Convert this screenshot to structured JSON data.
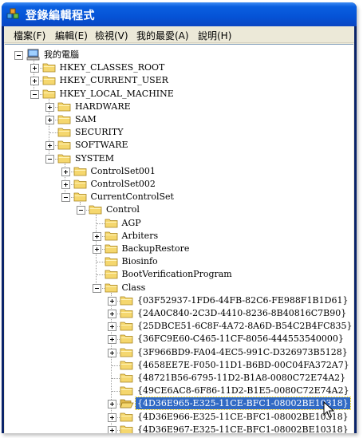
{
  "window": {
    "title": "登錄編輯程式"
  },
  "menu": [
    {
      "label": "檔案(F)"
    },
    {
      "label": "編輯(E)"
    },
    {
      "label": "檢視(V)"
    },
    {
      "label": "我的最愛(A)"
    },
    {
      "label": "說明(H)"
    }
  ],
  "tree": [
    {
      "label": "我的電腦",
      "level": 0,
      "state": "expanded",
      "icon": "computer-icon"
    },
    {
      "label": "HKEY_CLASSES_ROOT",
      "level": 1,
      "state": "collapsed",
      "icon": "folder-icon"
    },
    {
      "label": "HKEY_CURRENT_USER",
      "level": 1,
      "state": "collapsed",
      "icon": "folder-icon"
    },
    {
      "label": "HKEY_LOCAL_MACHINE",
      "level": 1,
      "state": "expanded",
      "icon": "folder-icon"
    },
    {
      "label": "HARDWARE",
      "level": 2,
      "state": "collapsed",
      "icon": "folder-icon"
    },
    {
      "label": "SAM",
      "level": 2,
      "state": "collapsed",
      "icon": "folder-icon"
    },
    {
      "label": "SECURITY",
      "level": 2,
      "state": "none",
      "icon": "folder-icon"
    },
    {
      "label": "SOFTWARE",
      "level": 2,
      "state": "collapsed",
      "icon": "folder-icon"
    },
    {
      "label": "SYSTEM",
      "level": 2,
      "state": "expanded",
      "icon": "folder-icon"
    },
    {
      "label": "ControlSet001",
      "level": 3,
      "state": "collapsed",
      "icon": "folder-icon"
    },
    {
      "label": "ControlSet002",
      "level": 3,
      "state": "collapsed",
      "icon": "folder-icon"
    },
    {
      "label": "CurrentControlSet",
      "level": 3,
      "state": "expanded",
      "icon": "folder-icon"
    },
    {
      "label": "Control",
      "level": 4,
      "state": "expanded",
      "icon": "folder-icon"
    },
    {
      "label": "AGP",
      "level": 5,
      "state": "none",
      "icon": "folder-icon"
    },
    {
      "label": "Arbiters",
      "level": 5,
      "state": "collapsed",
      "icon": "folder-icon"
    },
    {
      "label": "BackupRestore",
      "level": 5,
      "state": "collapsed",
      "icon": "folder-icon"
    },
    {
      "label": "Biosinfo",
      "level": 5,
      "state": "none",
      "icon": "folder-icon"
    },
    {
      "label": "BootVerificationProgram",
      "level": 5,
      "state": "none",
      "icon": "folder-icon"
    },
    {
      "label": "Class",
      "level": 5,
      "state": "expanded",
      "icon": "folder-icon"
    },
    {
      "label": "{03F52937-1FD6-44FB-82C6-FE988F1B1D61}",
      "level": 6,
      "state": "collapsed",
      "icon": "folder-icon"
    },
    {
      "label": "{24A0C840-2C3D-4410-8236-8B40816C7B90}",
      "level": 6,
      "state": "collapsed",
      "icon": "folder-icon"
    },
    {
      "label": "{25DBCE51-6C8F-4A72-8A6D-B54C2B4FC835}",
      "level": 6,
      "state": "collapsed",
      "icon": "folder-icon"
    },
    {
      "label": "{36FC9E60-C465-11CF-8056-444553540000}",
      "level": 6,
      "state": "collapsed",
      "icon": "folder-icon"
    },
    {
      "label": "{3F966BD9-FA04-4EC5-991C-D326973B5128}",
      "level": 6,
      "state": "collapsed",
      "icon": "folder-icon"
    },
    {
      "label": "{4658EE7E-F050-11D1-B6BD-00C04FA372A7}",
      "level": 6,
      "state": "none",
      "icon": "folder-icon"
    },
    {
      "label": "{48721B56-6795-11D2-B1A8-0080C72E74A2}",
      "level": 6,
      "state": "none",
      "icon": "folder-icon"
    },
    {
      "label": "{49CE6AC8-6F86-11D2-B1E5-0080C72E74A2}",
      "level": 6,
      "state": "none",
      "icon": "folder-icon"
    },
    {
      "label": "{4D36E965-E325-11CE-BFC1-08002BE10318}",
      "level": 6,
      "state": "collapsed",
      "icon": "open-folder-icon",
      "selected": true
    },
    {
      "label": "{4D36E966-E325-11CE-BFC1-08002BE10318}",
      "level": 6,
      "state": "collapsed",
      "icon": "folder-icon"
    },
    {
      "label": "{4D36E967-E325-11CE-BFC1-08002BE10318}",
      "level": 6,
      "state": "collapsed",
      "icon": "folder-icon"
    }
  ],
  "colors": {
    "selection": "#316ac5",
    "titlebar": "#0553d6",
    "folder": "#f5d76e"
  }
}
